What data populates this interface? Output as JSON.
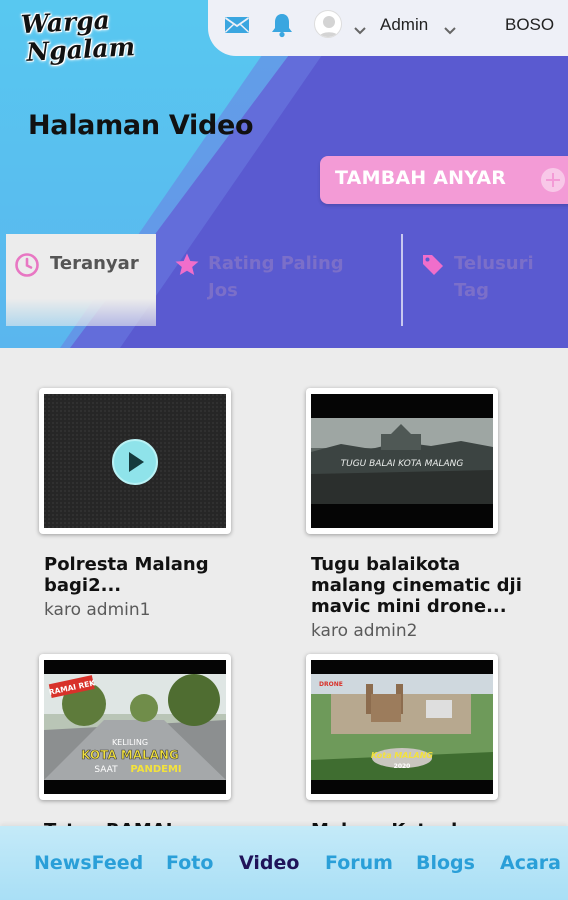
{
  "logo": {
    "line1": "Warga",
    "line2": "Ngalam"
  },
  "topbar": {
    "icons": [
      "mail-icon",
      "bell-icon",
      "avatar",
      "chevron-down-icon"
    ],
    "user": "Admin",
    "language": "BOSO"
  },
  "page_title": "Halaman Video",
  "add_button": {
    "label": "TAMBAH ANYAR",
    "icon": "plus-circle-icon"
  },
  "tabs": [
    {
      "label": "Teranyar",
      "icon": "clock-icon",
      "active": true
    },
    {
      "label": "Rating Paling Jos",
      "line1": "Rating Paling",
      "line2": "Jos",
      "icon": "star-icon",
      "active": false
    },
    {
      "label": "Telusuri Tag",
      "line1": "Telusuri",
      "line2": "Tag",
      "icon": "tag-icon",
      "active": false
    }
  ],
  "videos": [
    {
      "title_lines": [
        "Polresta Malang",
        "bagi2..."
      ],
      "author": "karo admin1",
      "thumb": "play-placeholder"
    },
    {
      "title_lines": [
        "Tugu balaikota",
        "malang cinematic dji",
        "mavic mini drone..."
      ],
      "author": "karo admin2",
      "overlay": "TUGU BALAI KOTA MALANG"
    },
    {
      "title_lines": [
        "Tetep RAMAI wong"
      ],
      "author": "",
      "badge": "RAMAI REK",
      "caption": [
        "KELILING",
        "KOTA MALANG",
        "SAAT",
        "PANDEMI"
      ]
    },
    {
      "title_lines": [
        "Malang Kota drone"
      ],
      "author": "",
      "label": "DRONE",
      "caption": [
        "Kota MALANG",
        "2020"
      ]
    }
  ],
  "bottom_nav": [
    "NewsFeed",
    "Foto",
    "Video",
    "Forum",
    "Blogs",
    "Acara"
  ],
  "active_nav": "Video",
  "colors": {
    "hero_purple": "#5a5ad0",
    "hero_blue": "#58c8f0",
    "accent_pink": "#f39bd6",
    "nav_blue": "#2a9fd8",
    "nav_active": "#20145a"
  }
}
